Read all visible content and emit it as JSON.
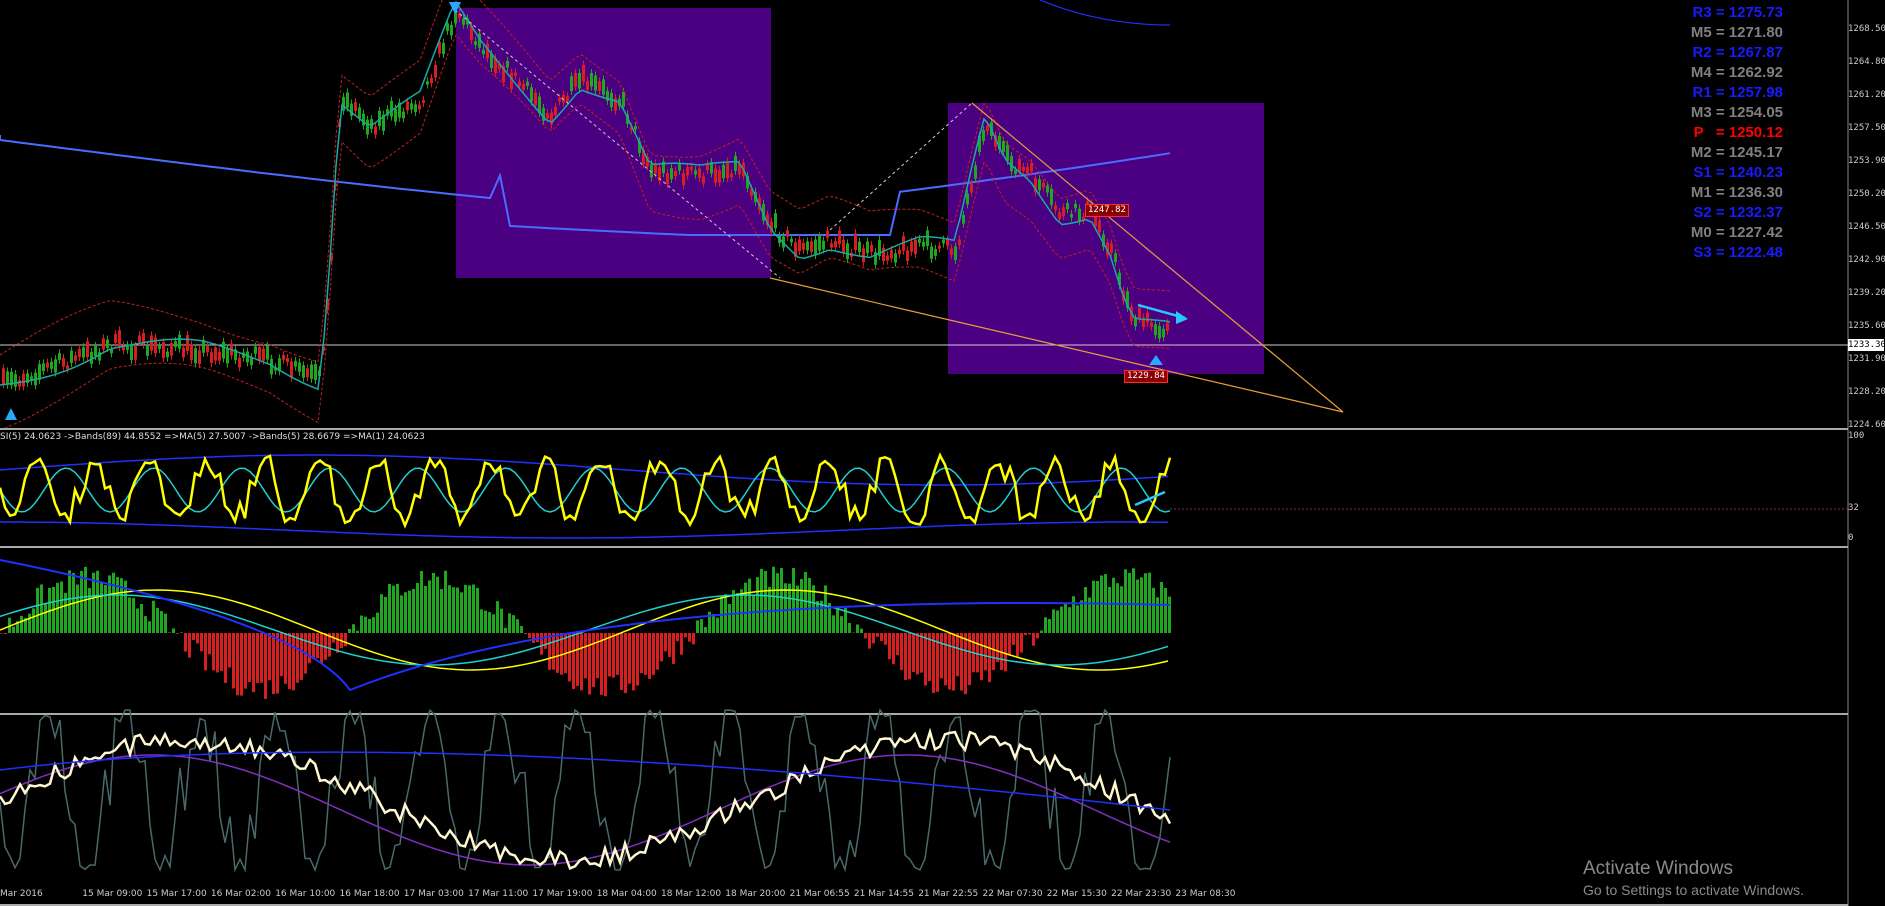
{
  "pivots": [
    {
      "label": "R3 = 1275.73",
      "color": "#1a1aff"
    },
    {
      "label": "M5 = 1271.80",
      "color": "#808080"
    },
    {
      "label": "R2 = 1267.87",
      "color": "#1a1aff"
    },
    {
      "label": "M4 = 1262.92",
      "color": "#808080"
    },
    {
      "label": "R1 = 1257.98",
      "color": "#1a1aff"
    },
    {
      "label": "M3 = 1254.05",
      "color": "#808080"
    },
    {
      "label": "P   = 1250.12",
      "color": "#ff0000"
    },
    {
      "label": "M2 = 1245.17",
      "color": "#808080"
    },
    {
      "label": "S1 = 1240.23",
      "color": "#1a1aff"
    },
    {
      "label": "M1 = 1236.30",
      "color": "#808080"
    },
    {
      "label": "S2 = 1232.37",
      "color": "#1a1aff"
    },
    {
      "label": "M0 = 1227.42",
      "color": "#808080"
    },
    {
      "label": "S3 = 1222.48",
      "color": "#1a1aff"
    }
  ],
  "price_axis": [
    "1268.50",
    "1264.80",
    "1261.20",
    "1257.50",
    "1253.90",
    "1250.20",
    "1246.50",
    "1242.90",
    "1239.20",
    "1235.60",
    "1231.90",
    "1228.20",
    "1224.60"
  ],
  "current_price": "1233.30",
  "rsi_axis": [
    "100",
    "32",
    "0"
  ],
  "rsi_label": "SI(5) 24.0623  ->Bands(89) 44.8552  =>MA(5) 27.5007  ->Bands(5) 28.6679  =>MA(1) 24.0623",
  "time_axis": [
    "Mar 2016",
    "15 Mar 09:00",
    "15 Mar 17:00",
    "16 Mar 02:00",
    "16 Mar 10:00",
    "16 Mar 18:00",
    "17 Mar 03:00",
    "17 Mar 11:00",
    "17 Mar 19:00",
    "18 Mar 04:00",
    "18 Mar 12:00",
    "18 Mar 20:00",
    "21 Mar 06:55",
    "21 Mar 14:55",
    "21 Mar 22:55",
    "22 Mar 07:30",
    "22 Mar 15:30",
    "22 Mar 23:30",
    "23 Mar 08:30"
  ],
  "tags": {
    "top": "1247.82",
    "low": "1229.84"
  },
  "watermark": {
    "title": "Activate Windows",
    "subtitle": "Go to Settings to activate Windows."
  },
  "colors": {
    "rect": "#4b0082",
    "bull": "#1fa81f",
    "bear": "#d81f1f",
    "rsi": "#ffff00",
    "band": "#2030ff"
  }
}
